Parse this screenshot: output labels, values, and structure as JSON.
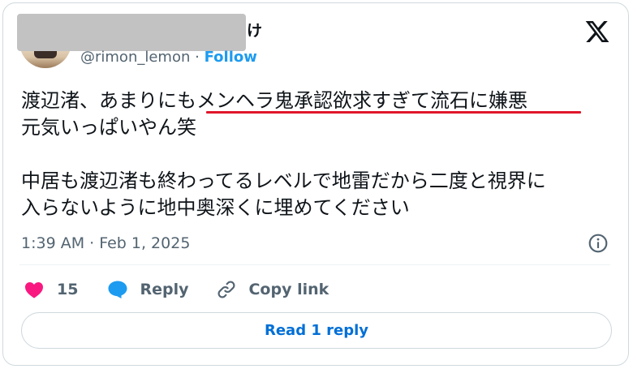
{
  "author": {
    "display_name_tail": "け",
    "handle": "@rimon_lemon",
    "separator": "·",
    "follow_label": "Follow"
  },
  "tweet": {
    "line1": "渡辺渚、あまりにもメンヘラ鬼承認欲求すぎて流石に嫌悪\n元気いっぱいやん笑",
    "line2": "中居も渡辺渚も終わってるレベルで地雷だから二度と視界に\n入らないように地中奥深くに埋めてください",
    "timestamp": "1:39 AM · Feb 1, 2025"
  },
  "actions": {
    "like_count": "15",
    "reply_label": "Reply",
    "copy_link_label": "Copy link"
  },
  "footer": {
    "read_reply_label": "Read 1 reply"
  },
  "colors": {
    "like": "#f91880",
    "reply": "#1d9bf0",
    "link": "#006fd6",
    "highlight_underline": "#e0162b"
  },
  "icons": {
    "platform": "x-logo-icon",
    "info": "info-icon",
    "like": "heart-icon",
    "reply": "speech-bubble-icon",
    "copy": "link-icon"
  }
}
